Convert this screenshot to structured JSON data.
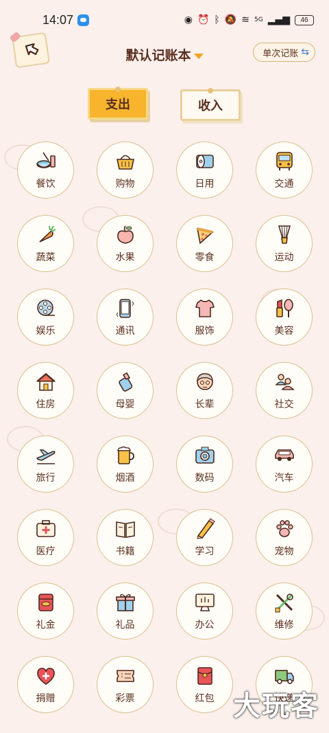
{
  "status_bar": {
    "time": "14:07",
    "battery": "46",
    "network": "5G"
  },
  "header": {
    "title": "默认记账本",
    "mode_button": "单次记账"
  },
  "tabs": [
    {
      "label": "支出",
      "active": true
    },
    {
      "label": "收入",
      "active": false
    }
  ],
  "categories": [
    {
      "label": "餐饮",
      "icon": "dining-icon"
    },
    {
      "label": "购物",
      "icon": "shopping-basket-icon"
    },
    {
      "label": "日用",
      "icon": "toilet-paper-icon"
    },
    {
      "label": "交通",
      "icon": "bus-icon"
    },
    {
      "label": "蔬菜",
      "icon": "carrot-icon"
    },
    {
      "label": "水果",
      "icon": "peach-icon"
    },
    {
      "label": "零食",
      "icon": "pizza-icon"
    },
    {
      "label": "运动",
      "icon": "shuttlecock-icon"
    },
    {
      "label": "娱乐",
      "icon": "film-reel-icon"
    },
    {
      "label": "通讯",
      "icon": "phone-icon"
    },
    {
      "label": "服饰",
      "icon": "tshirt-icon"
    },
    {
      "label": "美容",
      "icon": "lipstick-mirror-icon"
    },
    {
      "label": "住房",
      "icon": "house-icon"
    },
    {
      "label": "母婴",
      "icon": "baby-bottle-icon"
    },
    {
      "label": "长辈",
      "icon": "elder-icon"
    },
    {
      "label": "社交",
      "icon": "people-icon"
    },
    {
      "label": "旅行",
      "icon": "airplane-icon"
    },
    {
      "label": "烟酒",
      "icon": "beer-icon"
    },
    {
      "label": "数码",
      "icon": "camera-icon"
    },
    {
      "label": "汽车",
      "icon": "car-icon"
    },
    {
      "label": "医疗",
      "icon": "medical-kit-icon"
    },
    {
      "label": "书籍",
      "icon": "book-icon"
    },
    {
      "label": "学习",
      "icon": "pencil-icon"
    },
    {
      "label": "宠物",
      "icon": "paw-icon"
    },
    {
      "label": "礼金",
      "icon": "gift-money-icon"
    },
    {
      "label": "礼品",
      "icon": "gift-box-icon"
    },
    {
      "label": "办公",
      "icon": "monitor-icon"
    },
    {
      "label": "维修",
      "icon": "tools-icon"
    },
    {
      "label": "捐赠",
      "icon": "heart-plus-icon"
    },
    {
      "label": "彩票",
      "icon": "lottery-ticket-icon"
    },
    {
      "label": "红包",
      "icon": "red-envelope-icon"
    },
    {
      "label": "快递",
      "icon": "delivery-truck-icon"
    }
  ],
  "watermark": "大玩客",
  "colors": {
    "background": "#fbf0ec",
    "accent": "#f7b42c",
    "text": "#5a2f1f",
    "border": "#dcc08e"
  }
}
